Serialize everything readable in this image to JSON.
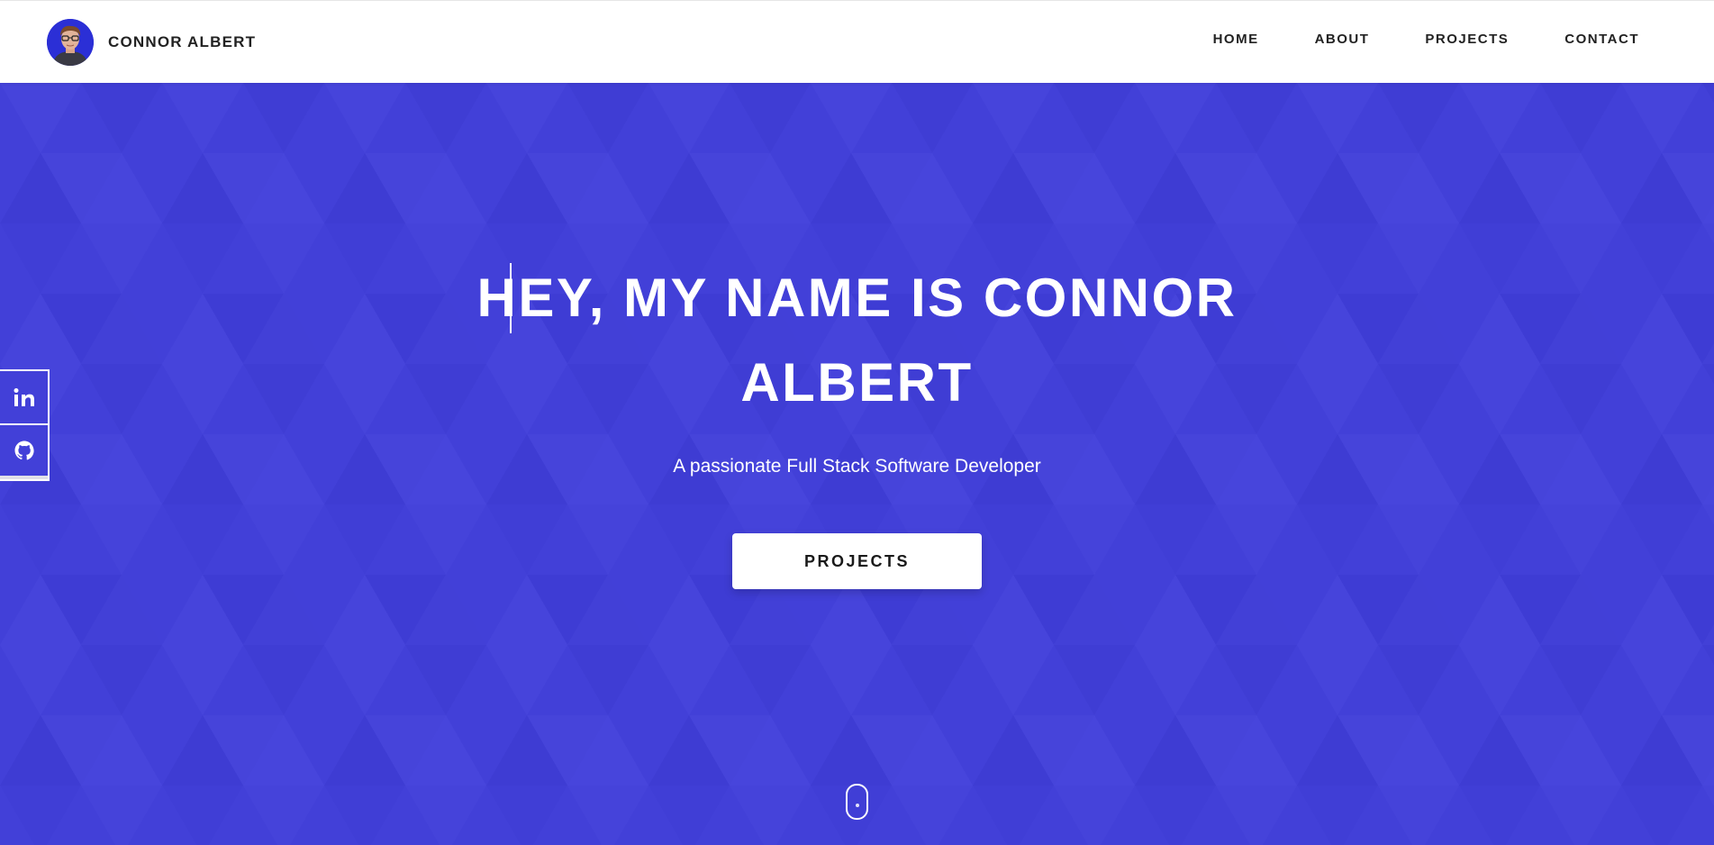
{
  "header": {
    "brand_name": "CONNOR ALBERT",
    "avatar_icon": "profile-photo",
    "nav": [
      "HOME",
      "ABOUT",
      "PROJECTS",
      "CONTACT"
    ]
  },
  "hero": {
    "title_line1": "HEY, MY NAME IS CONNOR",
    "title_line2": "ALBERT",
    "subtitle": "A passionate Full Stack Software Developer",
    "cta_label": "PROJECTS",
    "scroll_icon": "mouse-scroll-icon"
  },
  "social": [
    {
      "icon": "linkedin-icon",
      "glyph": "in"
    },
    {
      "icon": "github-icon"
    }
  ],
  "colors": {
    "hero_bg": "#4240d8",
    "header_bg": "#ffffff",
    "text_dark": "#222222",
    "text_light": "#ffffff"
  }
}
